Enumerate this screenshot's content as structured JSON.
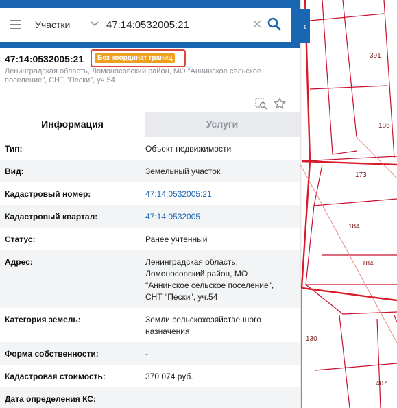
{
  "search": {
    "layer": "Участки",
    "query": "47:14:0532005:21"
  },
  "object": {
    "title": "47:14:0532005:21",
    "badge": "Без координат границ",
    "address": "Ленинградская область, Ломоносовский район, МО \"Аннинское сельское поселение\", СНТ \"Пески\", уч.54"
  },
  "tabs": {
    "info": "Информация",
    "services": "Услуги"
  },
  "rows": [
    {
      "label": "Тип:",
      "value": "Объект недвижимости"
    },
    {
      "label": "Вид:",
      "value": "Земельный участок"
    },
    {
      "label": "Кадастровый номер:",
      "value": "47:14:0532005:21"
    },
    {
      "label": "Кадастровый квартал:",
      "value": "47:14:0532005"
    },
    {
      "label": "Статус:",
      "value": "Ранее учтенный"
    },
    {
      "label": "Адрес:",
      "value": "Ленинградская область, Ломоносовский район, МО \"Аннинское сельское поселение\", СНТ \"Пески\", уч.54"
    },
    {
      "label": "Категория земель:",
      "value": "Земли сельскохозяйственного назначения"
    },
    {
      "label": "Форма собственности:",
      "value": "-"
    },
    {
      "label": "Кадастровая стоимость:",
      "value": "370 074 руб."
    },
    {
      "label": "Дата определения КС:",
      "value": ""
    }
  ],
  "map": {
    "plot_labels": [
      "391",
      "186",
      "173",
      "184",
      "184",
      "130",
      "407"
    ]
  },
  "colors": {
    "header": "#1a66b3",
    "badge": "#f0a020",
    "highlight": "#d9463b",
    "link": "#1a66b3",
    "boundary": "#c8102e"
  }
}
